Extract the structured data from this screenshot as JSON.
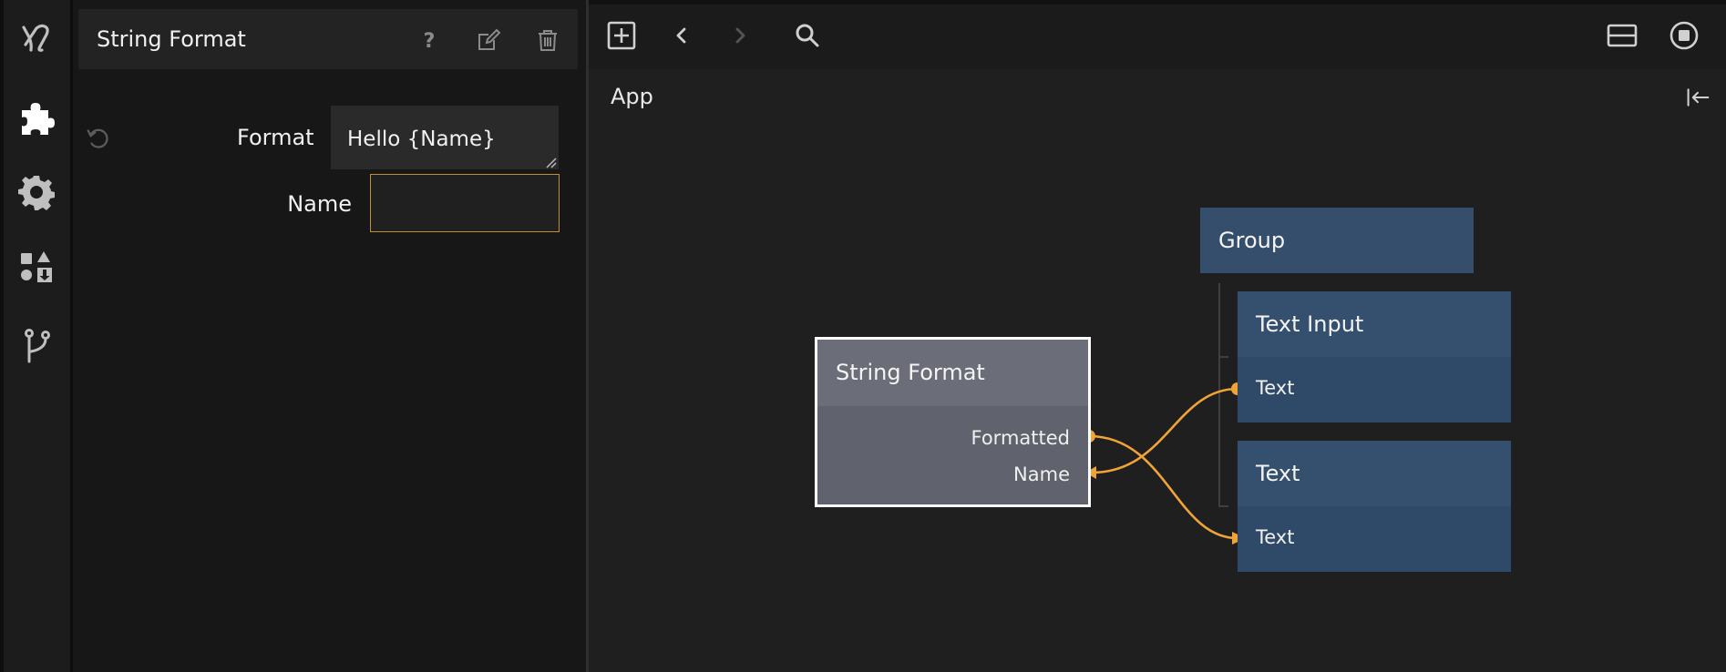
{
  "panel": {
    "title": "String Format",
    "properties": {
      "format_label": "Format",
      "format_value": "Hello {Name}",
      "name_label": "Name",
      "name_value": ""
    }
  },
  "canvas": {
    "breadcrumb": "App",
    "nodes": {
      "string_format": {
        "title": "String Format",
        "ports": [
          "Formatted",
          "Name"
        ]
      },
      "group": {
        "title": "Group"
      },
      "text_input": {
        "title": "Text Input",
        "port": "Text"
      },
      "text": {
        "title": "Text",
        "port": "Text"
      }
    }
  },
  "colors": {
    "accent": "#f0a437",
    "node_logic": "#60636e",
    "node_visual": "#2f4a68",
    "focus_border": "#c08f2e"
  },
  "icons": {
    "rail": [
      "app-logo-icon",
      "puzzle-icon",
      "gear-icon",
      "shapes-download-icon",
      "branch-icon"
    ],
    "panel_header": [
      "help-icon",
      "edit-icon",
      "trash-icon"
    ],
    "toolbar": [
      "add-node-icon",
      "chevron-left-icon",
      "chevron-right-icon",
      "search-icon",
      "split-view-icon",
      "stop-icon"
    ]
  }
}
